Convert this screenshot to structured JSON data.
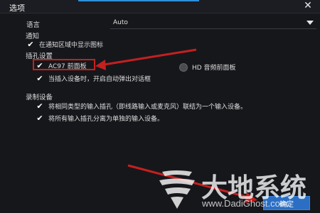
{
  "window": {
    "title": "选项",
    "close_glyph": "✕"
  },
  "language": {
    "label": "语言",
    "value": "Auto"
  },
  "notification": {
    "section": "通知",
    "show_tray_icon": "在通知区域中显示图标"
  },
  "jack_settings": {
    "section": "插孔设置",
    "ac97_label": "AC97 前面板",
    "hd_label": "HD 音频前面板",
    "auto_popup_label": "当插入设备时，开启自动弹出对话框"
  },
  "recording": {
    "section": "录制设备",
    "merge_inputs": "将相同类型的输入插孔（即线路输入或麦克风）联结为一个输入设备。",
    "separate_inputs": "将所有输入插孔分离为单独的输入设备。"
  },
  "footer": {
    "ok_label": "确定"
  },
  "watermark": {
    "logo_text": "大地系统",
    "url": "www.DadiGhost.com"
  },
  "colors": {
    "background": "#16171b",
    "accent": "#2f8fd8",
    "highlight_box": "#c42020",
    "arrow": "#c42020"
  }
}
